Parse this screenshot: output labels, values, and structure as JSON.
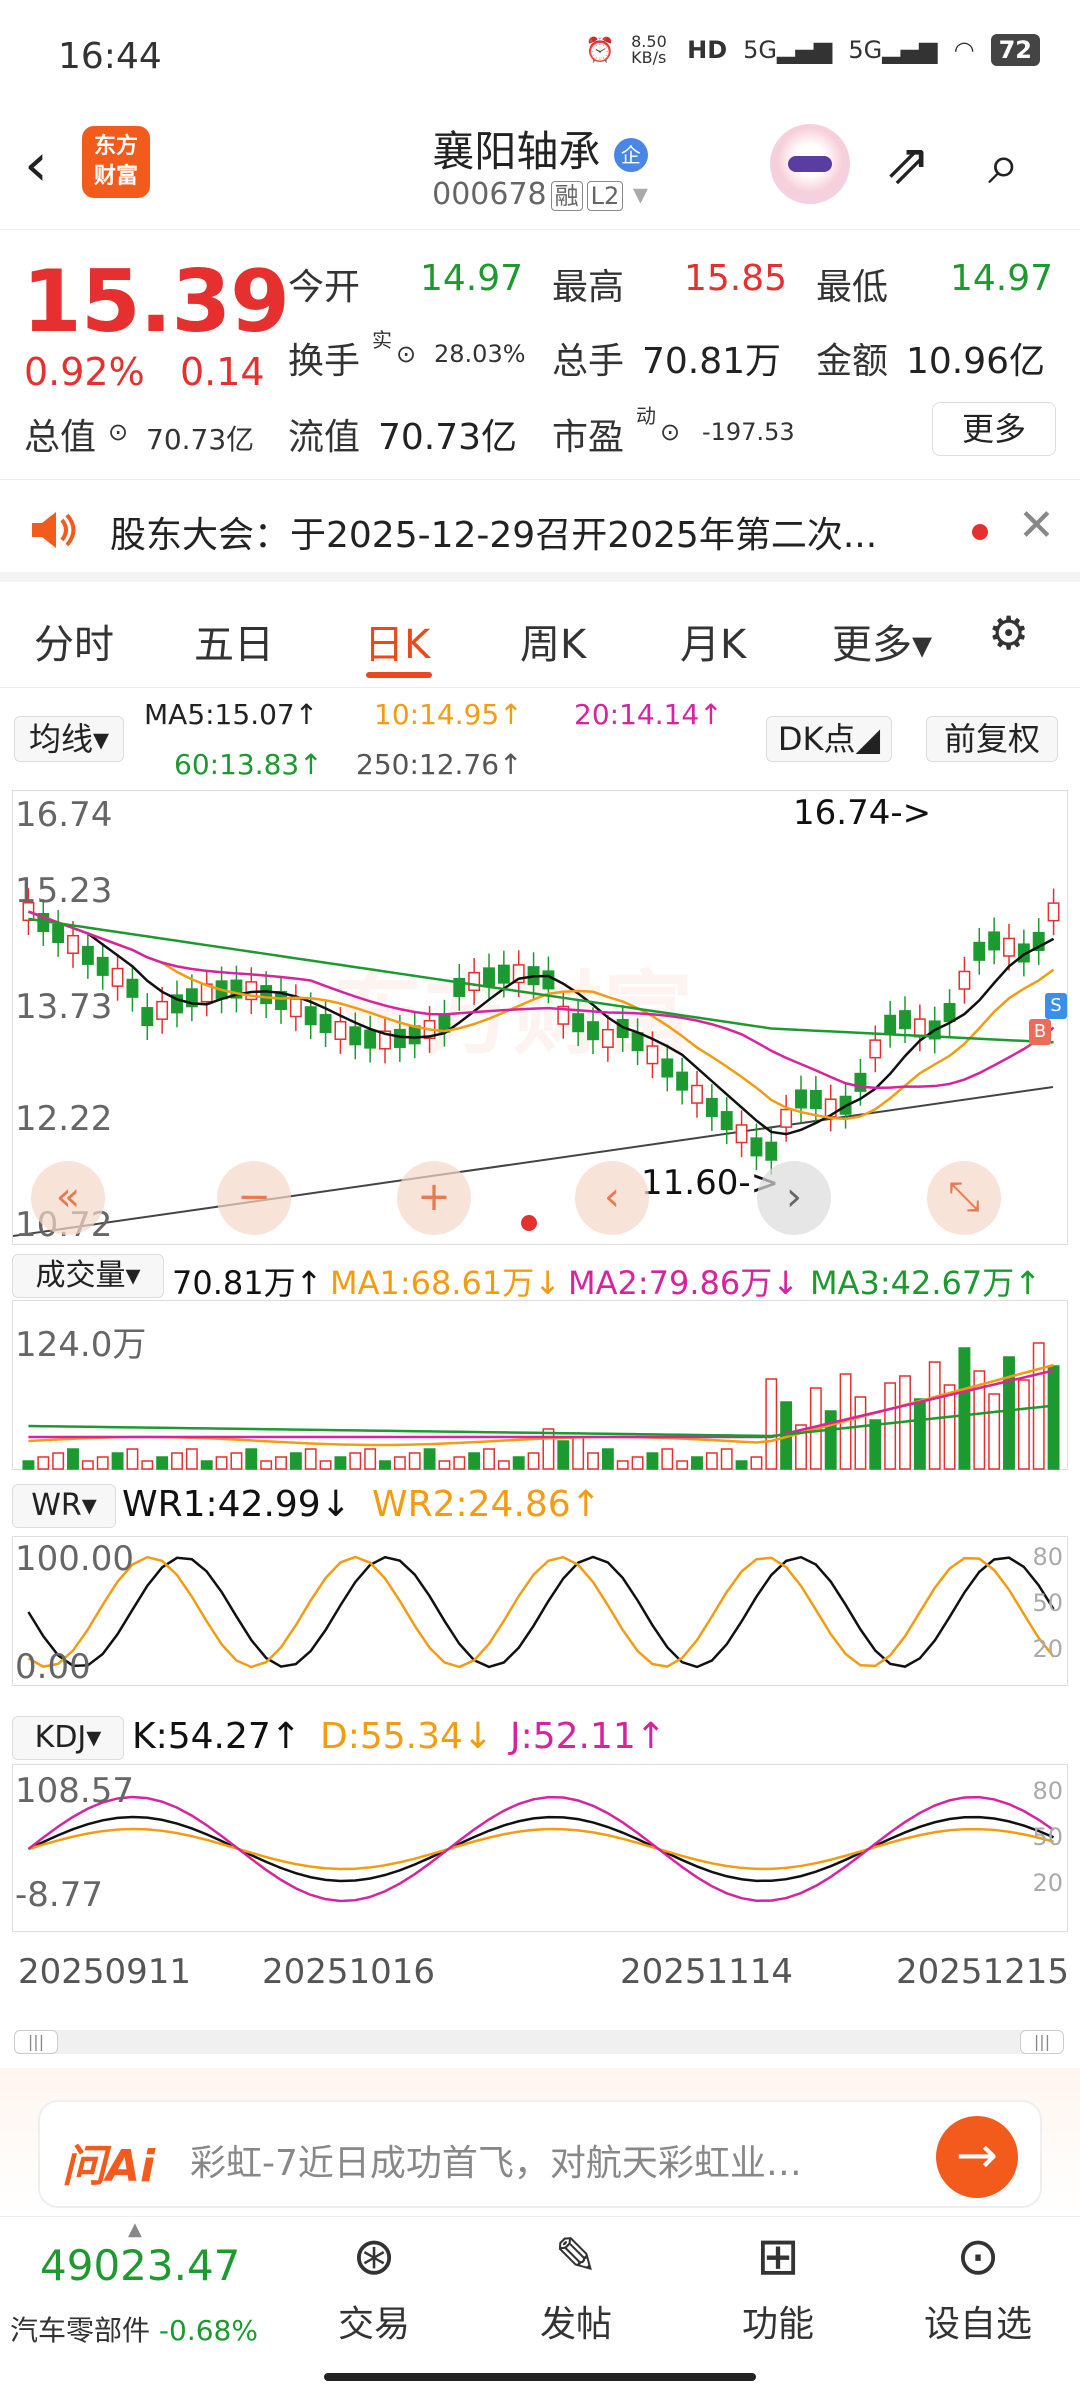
{
  "status": {
    "time": "16:44",
    "speed": "8.50 KB/s",
    "net1": "5G",
    "net2": "5G",
    "hd": "HD",
    "battery": "72"
  },
  "header": {
    "back": "‹",
    "logo_line1": "东方",
    "logo_line2": "财富",
    "name": "襄阳轴承",
    "badge": "企",
    "code": "000678",
    "tag1": "融",
    "tag2": "L2"
  },
  "quote": {
    "price": "15.39",
    "pct": "0.92%",
    "change": "0.14",
    "open_label": "今开",
    "open": "14.97",
    "high_label": "最高",
    "high": "15.85",
    "low_label": "最低",
    "low": "14.97",
    "turnover_label": "换手",
    "turnover_sup": "实",
    "turnover": "28.03%",
    "vol_label": "总手",
    "vol": "70.81万",
    "amount_label": "金额",
    "amount": "10.96亿",
    "mcap_label": "总值",
    "mcap": "70.73亿",
    "float_label": "流值",
    "float": "70.73亿",
    "pe_label": "市盈",
    "pe_sup": "动",
    "pe": "-197.53",
    "more": "更多"
  },
  "notice": {
    "text": "股东大会：于2025-12-29召开2025年第二次..."
  },
  "tabs": [
    "分时",
    "五日",
    "日K",
    "周K",
    "月K",
    "更多▾"
  ],
  "ma": {
    "selector": "均线",
    "ma5": "MA5:15.07↑",
    "ma10": "10:14.95↑",
    "ma20": "20:14.14↑",
    "ma60": "60:13.83↑",
    "ma250": "250:12.76↑",
    "dk": "DK点",
    "fq": "前复权"
  },
  "kchart": {
    "y1": "16.74",
    "y2": "15.23",
    "y3": "13.73",
    "y4": "12.22",
    "y5": "10.72",
    "hi_note": "16.74->",
    "lo_note": "11.60->",
    "watermark": "东方财富",
    "ctrl1": "«",
    "ctrl2": "−",
    "ctrl3": "+",
    "ctrl4": "‹",
    "ctrl5": "›",
    "ctrl6": "⤡",
    "tag_s": "S",
    "tag_b": "B"
  },
  "vol": {
    "selector": "成交量",
    "v": "70.81万↑",
    "ma1": "MA1:68.61万↓",
    "ma2": "MA2:79.86万↓",
    "ma3": "MA3:42.67万↑",
    "ymax": "124.0万"
  },
  "wr": {
    "selector": "WR",
    "wr1": "WR1:42.99↓",
    "wr2": "WR2:24.86↑",
    "ytop": "100.00",
    "ybot": "0.00",
    "r80": "80",
    "r50": "50",
    "r20": "20"
  },
  "kdj": {
    "selector": "KDJ",
    "k": "K:54.27↑",
    "d": "D:55.34↓",
    "j": "J:52.11↑",
    "ytop": "108.57",
    "ybot": "-8.77",
    "r80": "80",
    "r50": "50",
    "r20": "20"
  },
  "dates": [
    "20250911",
    "20251016",
    "20251114",
    "20251215"
  ],
  "ask": {
    "logo": "问Ai",
    "text": "彩虹-7近日成功首飞，对航天彩虹业…",
    "go": "→"
  },
  "bottom": {
    "index_val": "49023.47",
    "index_name": "汽车零部件",
    "index_pct": "-0.68%",
    "items": [
      "交易",
      "发帖",
      "功能",
      "设自选"
    ]
  },
  "colors": {
    "up": "#e5302f",
    "down": "#1d9a2f",
    "accent": "#e84a1c",
    "ma5": "#111111",
    "ma10": "#f39c12",
    "ma20": "#d6249f",
    "ma60": "#1d9a2f"
  }
}
